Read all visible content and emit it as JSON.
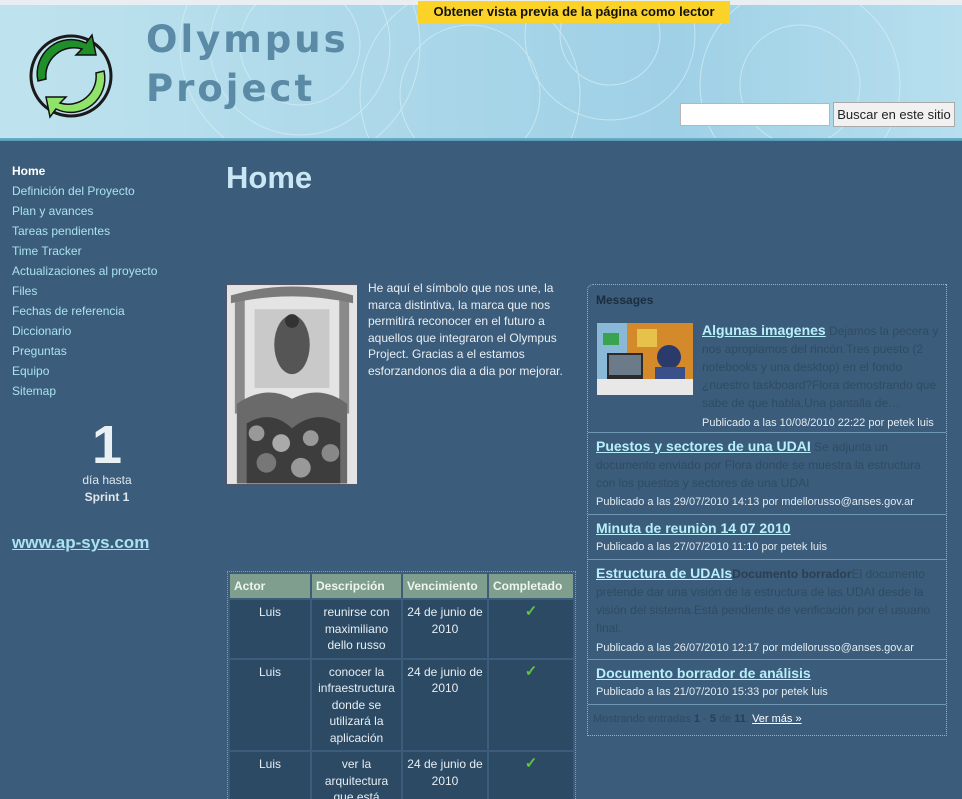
{
  "header": {
    "site_title_line1": "Olympus",
    "site_title_line2": "Project",
    "reader_button": "Obtener vista previa de la página como lector",
    "search_placeholder": "",
    "search_button": "Buscar en este sitio"
  },
  "nav": {
    "items": [
      {
        "label": "Home",
        "active": true
      },
      {
        "label": "Definición del Proyecto"
      },
      {
        "label": "Plan y avances"
      },
      {
        "label": "Tareas pendientes"
      },
      {
        "label": "Time Tracker"
      },
      {
        "label": "Actualizaciones al proyecto"
      },
      {
        "label": "Files"
      },
      {
        "label": "Fechas de referencia"
      },
      {
        "label": "Diccionario"
      },
      {
        "label": "Preguntas"
      },
      {
        "label": "Equipo"
      },
      {
        "label": "Sitemap"
      }
    ]
  },
  "countdown": {
    "number": "1",
    "label": "día hasta",
    "event": "Sprint 1"
  },
  "external_link": "www.ap-sys.com",
  "main": {
    "title": "Home",
    "intro": "He aquí el símbolo que nos une, la marca distintiva, la marca que nos permitirá reconocer en el futuro  a  aquellos que  integraron el Olympus Project. Gracias a el estamos esforzandonos dia a dia por mejorar."
  },
  "tasks": {
    "headers": [
      "Actor",
      "Descripción",
      "Vencimiento",
      "Completado"
    ],
    "rows": [
      {
        "actor": "Luis",
        "description": "reunirse con maximiliano dello russo",
        "due": "24 de junio de 2010",
        "done": "✓"
      },
      {
        "actor": "Luis",
        "description": "conocer la infraestructura donde se utilizará la aplicación",
        "due": "24 de junio de 2010",
        "done": "✓"
      },
      {
        "actor": "Luis",
        "description": "ver la arquitectura que está",
        "due": "24 de junio de 2010",
        "done": "✓"
      }
    ]
  },
  "messages": {
    "title": "Messages",
    "posts": [
      {
        "title": "Algunas imagenes",
        "excerpt": "Dejamos la pecera y nos apropiamos del rincón.Tres puesto (2 notebooks y una desktop) en el fondo ¿nuestro taskboard?Flora demostrando que sabe de que habla.Una pantalla de…",
        "meta": "Publicado a las 10/08/2010 22:22 por petek luis"
      },
      {
        "title": "Puestos y sectores de una UDAI",
        "excerpt": "Se adjunta un documento enviado por Flora donde se muestra la estructura con los puestos y sectores de una UDAI",
        "meta": "Publicado a las 29/07/2010 14:13 por mdellorusso@anses.gov.ar"
      },
      {
        "title": "Minuta de reuniòn 14 07 2010",
        "excerpt": "",
        "meta": "Publicado a las 27/07/2010 11:10 por petek luis"
      },
      {
        "title": "Estructura de UDAIs",
        "excerpt_bold": "Documento borrador",
        "excerpt": "El documento pretende dar una visión de la estructura de las UDAI desde la visión del sistema.Está pendiente de verificación por el usuario final.",
        "meta": "Publicado a las 26/07/2010 12:17 por mdellorusso@anses.gov.ar"
      },
      {
        "title": "Documento borrador de análisis",
        "excerpt": "",
        "meta": "Publicado a las 21/07/2010 15:33 por petek luis"
      }
    ],
    "footer_prefix": "Mostrando entradas",
    "footer_range_start": "1",
    "footer_range_sep": " - ",
    "footer_range_end": "5",
    "footer_of": " de ",
    "footer_total": "11",
    "footer_dot": ".",
    "see_more": "Ver más »"
  }
}
